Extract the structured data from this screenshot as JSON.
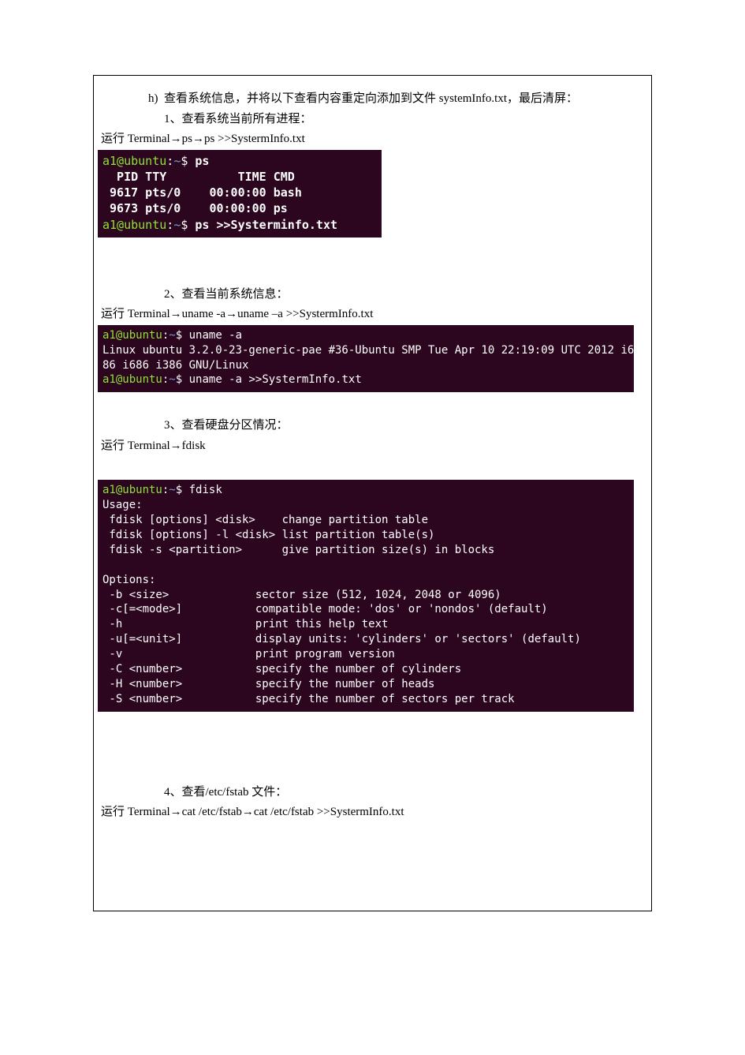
{
  "doc": {
    "h_bullet": "h)",
    "h_text": "查看系统信息，并将以下查看内容重定向添加到文件 systemInfo.txt，最后清屏：",
    "step1_label": "1、查看系统当前所有进程：",
    "step1_run": "运行 Terminal→ps→ps  >>SystermInfo.txt",
    "step2_label": "2、查看当前系统信息：",
    "step2_run": "运行 Terminal→uname  -a→uname  –a  >>SystermInfo.txt",
    "step3_label": "3、查看硬盘分区情况：",
    "step3_run": "运行 Terminal→fdisk",
    "step4_label": "4、查看/etc/fstab 文件：",
    "step4_run": "运行 Terminal→cat    /etc/fstab→cat    /etc/fstab  >>SystermInfo.txt"
  },
  "terminal": {
    "prompt_user": "a1@ubuntu",
    "prompt_sep": ":",
    "prompt_path": "~",
    "prompt_end": "$",
    "ps_cmd": "ps",
    "ps_header": "  PID TTY          TIME CMD",
    "ps_row1": " 9617 pts/0    00:00:00 bash",
    "ps_row2": " 9673 pts/0    00:00:00 ps",
    "ps_redirect": "ps >>Systerminfo.txt",
    "uname_cmd": "uname -a",
    "uname_out": "Linux ubuntu 3.2.0-23-generic-pae #36-Ubuntu SMP Tue Apr 10 22:19:09 UTC 2012 i686 i686 i386 GNU/Linux",
    "uname_out_line1": "Linux ubuntu 3.2.0-23-generic-pae #36-Ubuntu SMP Tue Apr 10 22:19:09 UTC 2012 i6",
    "uname_out_line2": "86 i686 i386 GNU/Linux",
    "uname_redirect": "uname -a >>SystermInfo.txt",
    "fdisk_cmd": "fdisk",
    "fdisk_lines": [
      "Usage:",
      " fdisk [options] <disk>    change partition table",
      " fdisk [options] -l <disk> list partition table(s)",
      " fdisk -s <partition>      give partition size(s) in blocks",
      "",
      "Options:",
      " -b <size>             sector size (512, 1024, 2048 or 4096)",
      " -c[=<mode>]           compatible mode: 'dos' or 'nondos' (default)",
      " -h                    print this help text",
      " -u[=<unit>]           display units: 'cylinders' or 'sectors' (default)",
      " -v                    print program version",
      " -C <number>           specify the number of cylinders",
      " -H <number>           specify the number of heads",
      " -S <number>           specify the number of sectors per track"
    ]
  }
}
